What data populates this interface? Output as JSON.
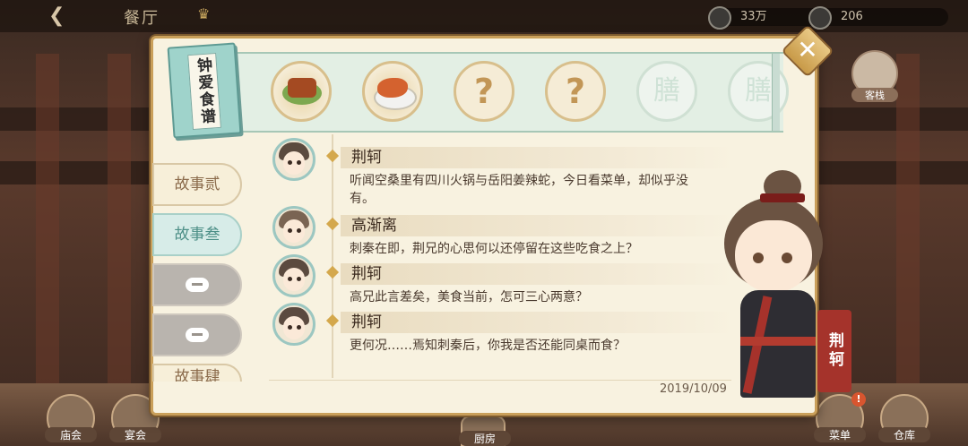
{
  "topbar": {
    "title": "餐厅",
    "currency": {
      "value": "33万"
    },
    "gems": {
      "value": "206"
    }
  },
  "side": {
    "guest_label": "客栈"
  },
  "bottom": {
    "left1_label": "庙会",
    "left2_label": "宴会",
    "center_label": "厨房",
    "right1_label": "菜单",
    "right2_label": "仓库",
    "right1_badge": "!"
  },
  "book": {
    "label": "钟爱食谱"
  },
  "dishes": [
    {
      "state": "food",
      "icon": "braised-meat-dish-icon"
    },
    {
      "state": "food",
      "icon": "fish-dish-icon"
    },
    {
      "state": "unknown",
      "mark": "?"
    },
    {
      "state": "unknown",
      "mark": "?"
    },
    {
      "state": "locked",
      "mark": "膳"
    },
    {
      "state": "locked",
      "mark": "膳"
    }
  ],
  "tabs": [
    {
      "label": "故事贰"
    },
    {
      "label": "故事叁"
    },
    {
      "label": ""
    },
    {
      "label": ""
    },
    {
      "label": "故事肆"
    }
  ],
  "dialogue": [
    {
      "name": "荆轲",
      "text": "听闻空桑里有四川火锅与岳阳姜辣蛇，今日看菜单，却似乎没有。"
    },
    {
      "name": "高渐离",
      "text": "刺秦在即，荆兄的心思何以还停留在这些吃食之上？"
    },
    {
      "name": "荆轲",
      "text": "高兄此言差矣，美食当前，怎可三心两意？"
    },
    {
      "name": "荆轲",
      "text": "更何况……焉知刺秦后，你我是否还能同桌而食？"
    }
  ],
  "date": "2019/10/09",
  "character": {
    "name": "荆轲"
  },
  "close": {
    "symbol": "✕"
  },
  "colors": {
    "accent": "#c99f5a",
    "teal": "#9fd3cb",
    "banner": "#a5332b"
  }
}
